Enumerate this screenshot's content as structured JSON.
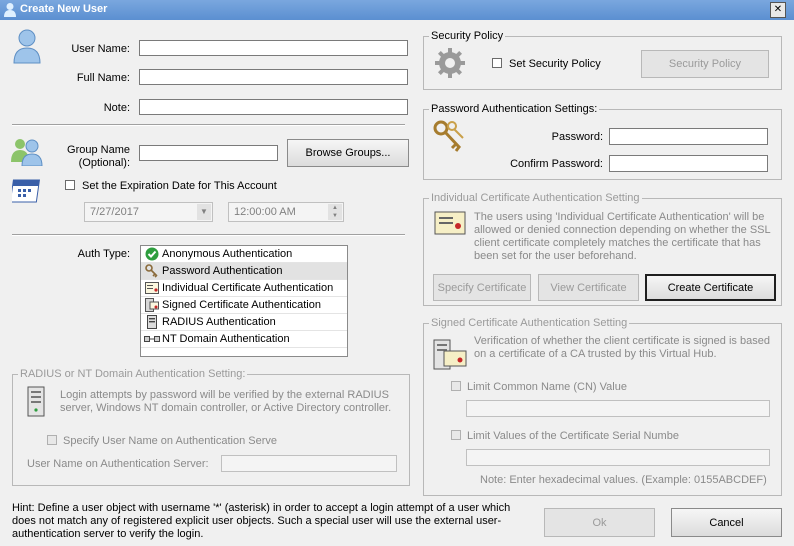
{
  "window": {
    "title": "Create New User",
    "close": "✕"
  },
  "user": {
    "user_name_label": "User Name:",
    "full_name_label": "Full Name:",
    "note_label": "Note:",
    "user_name": "",
    "full_name": "",
    "note": ""
  },
  "group": {
    "label_line1": "Group Name",
    "label_line2": "(Optional):",
    "value": "",
    "browse_button": "Browse Groups..."
  },
  "expiration": {
    "checkbox_label": "Set the Expiration Date for This Account",
    "date": "7/27/2017",
    "time": "12:00:00 AM"
  },
  "auth": {
    "label": "Auth Type:",
    "types": [
      {
        "label": "Anonymous Authentication",
        "icon": "check-circle-icon"
      },
      {
        "label": "Password Authentication",
        "icon": "key-icon"
      },
      {
        "label": "Individual Certificate Authentication",
        "icon": "certificate-icon"
      },
      {
        "label": "Signed Certificate Authentication",
        "icon": "signed-certificate-icon"
      },
      {
        "label": "RADIUS Authentication",
        "icon": "server-icon"
      },
      {
        "label": "NT Domain Authentication",
        "icon": "network-icon"
      }
    ],
    "selected": "Password Authentication"
  },
  "radius": {
    "legend": "RADIUS or NT Domain Authentication Setting:",
    "description": "Login attempts by password will be verified by the external RADIUS server, Windows NT domain controller, or Active Directory controller.",
    "specify_checkbox": "Specify User Name on Authentication Serve",
    "server_user_label": "User Name on Authentication Server:",
    "server_user_value": ""
  },
  "security_policy": {
    "legend": "Security Policy",
    "checkbox": "Set Security Policy",
    "button": "Security Policy"
  },
  "password_settings": {
    "legend": "Password Authentication Settings:",
    "password_label": "Password:",
    "confirm_label": "Confirm Password:",
    "password": "",
    "confirm": ""
  },
  "individual_cert": {
    "legend": "Individual Certificate Authentication Setting",
    "description": "The users using 'Individual Certificate Authentication' will be allowed or denied connection depending on whether the SSL client certificate completely matches the certificate that has been set for the user beforehand.",
    "specify_button": "Specify Certificate",
    "view_button": "View Certificate",
    "create_button": "Create Certificate"
  },
  "signed_cert": {
    "legend": "Signed Certificate Authentication Setting",
    "description": "Verification of whether the client certificate is signed is based on a certificate of a CA trusted by this Virtual Hub.",
    "limit_cn": "Limit Common Name (CN) Value",
    "limit_serial": "Limit Values of the Certificate Serial Numbe",
    "cn_value": "",
    "serial_value": "",
    "note": "Note: Enter hexadecimal values. (Example: 0155ABCDEF)"
  },
  "hint": "Hint: Define a user object with username '*' (asterisk) in order to accept a login attempt of a user which does not match any of registered explicit user objects. Such a special user will use the external user-authentication server to verify the login.",
  "footer": {
    "ok": "Ok",
    "cancel": "Cancel"
  },
  "colors": {
    "titlebar": "#5b8fd1",
    "selected_row": "#e2e2e2"
  }
}
